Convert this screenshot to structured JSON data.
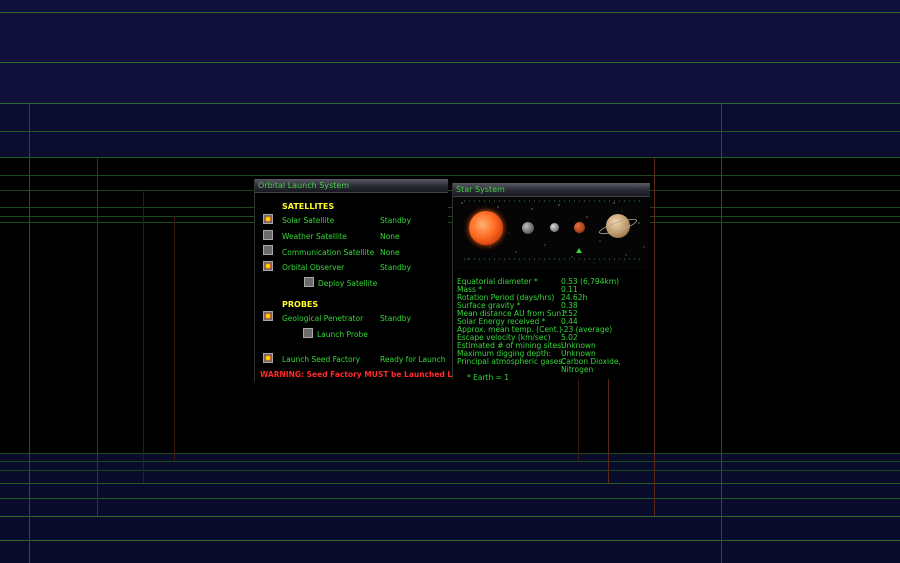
{
  "launch_window": {
    "title": "Orbital Launch System",
    "satellites_header": "SATELLITES",
    "satellites": [
      {
        "label": "Solar Satellite",
        "status": "Standby",
        "checked": true
      },
      {
        "label": "Weather Satellite",
        "status": "None",
        "checked": false
      },
      {
        "label": "Communication Satellite",
        "status": "None",
        "checked": false
      },
      {
        "label": "Orbital Observer",
        "status": "Standby",
        "checked": true
      }
    ],
    "deploy_label": "Deploy Satellite",
    "probes_header": "PROBES",
    "probe": {
      "label": "Geological Penetrator",
      "status": "Standby",
      "checked": true
    },
    "launch_probe_label": "Launch Probe",
    "seed_factory": {
      "label": "Launch Seed Factory",
      "status": "Ready for Launch",
      "checked": true
    },
    "warning": "WARNING: Seed Factory MUST be Launched Last!"
  },
  "star_window": {
    "title": "Star System",
    "stats": [
      {
        "label": "Equatorial diameter *",
        "value": "0.53 (6,794km)"
      },
      {
        "label": "Mass *",
        "value": "0.11"
      },
      {
        "label": "Rotation Period (days/hrs)",
        "value": "24.62h"
      },
      {
        "label": "Surface gravity *",
        "value": "0.38"
      },
      {
        "label": "Mean distance AU from Sun *",
        "value": "1.52"
      },
      {
        "label": "Solar Energy received *",
        "value": "0.44"
      },
      {
        "label": "Approx. mean temp. (Cent.)",
        "value": "-23 (average)"
      },
      {
        "label": "Escape velocity (km/sec)",
        "value": "5.02"
      },
      {
        "label": "Estimated # of mining sites:",
        "value": "Unknown"
      },
      {
        "label": "Maximum digging depth:",
        "value": "Unknown"
      },
      {
        "label": "Principal atmospheric gases",
        "value": "Carbon Dioxide,"
      }
    ],
    "stats_continuation": "Nitrogen",
    "footnote": "* Earth = 1",
    "selector_icon": "triangle-up-icon"
  },
  "colors": {
    "text_green": "#35d63a",
    "header_yellow": "#ffff2a",
    "warning_red": "#ff2a2a",
    "background_navy": "#0c0c36",
    "line_green": "#1f6a1f",
    "line_red": "#6a2a18"
  }
}
